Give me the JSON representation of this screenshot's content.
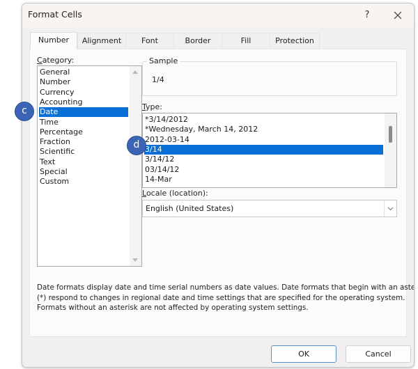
{
  "window": {
    "title": "Format Cells",
    "help_label": "?",
    "close_icon": "close-icon"
  },
  "tabs": [
    {
      "label": "Number",
      "active": true
    },
    {
      "label": "Alignment",
      "active": false
    },
    {
      "label": "Font",
      "active": false
    },
    {
      "label": "Border",
      "active": false
    },
    {
      "label": "Fill",
      "active": false
    },
    {
      "label": "Protection",
      "active": false
    }
  ],
  "category": {
    "label_underlined": "C",
    "label_rest": "ategory:",
    "items": [
      "General",
      "Number",
      "Currency",
      "Accounting",
      "Date",
      "Time",
      "Percentage",
      "Fraction",
      "Scientific",
      "Text",
      "Special",
      "Custom"
    ],
    "selected": "Date"
  },
  "sample": {
    "label": "Sample",
    "value": "1/4"
  },
  "type": {
    "label_underlined": "T",
    "label_rest": "ype:",
    "items": [
      "*3/14/2012",
      "*Wednesday, March 14, 2012",
      "2012-03-14",
      "3/14",
      "3/14/12",
      "03/14/12",
      "14-Mar"
    ],
    "selected": "3/14"
  },
  "locale": {
    "label_underlined": "L",
    "label_rest": "ocale (location):",
    "value": "English (United States)"
  },
  "description": [
    "Date formats display date and time serial numbers as date values.  Date formats that begin with an asterisk",
    "(*) respond to changes in regional date and time settings that are specified for the operating system.",
    "Formats without an asterisk are not affected by operating system settings."
  ],
  "buttons": {
    "ok": "OK",
    "cancel": "Cancel"
  },
  "callouts": {
    "c": "c",
    "d": "d"
  },
  "colors": {
    "selection": "#0a6fd6",
    "callout": "#3c64b4"
  }
}
